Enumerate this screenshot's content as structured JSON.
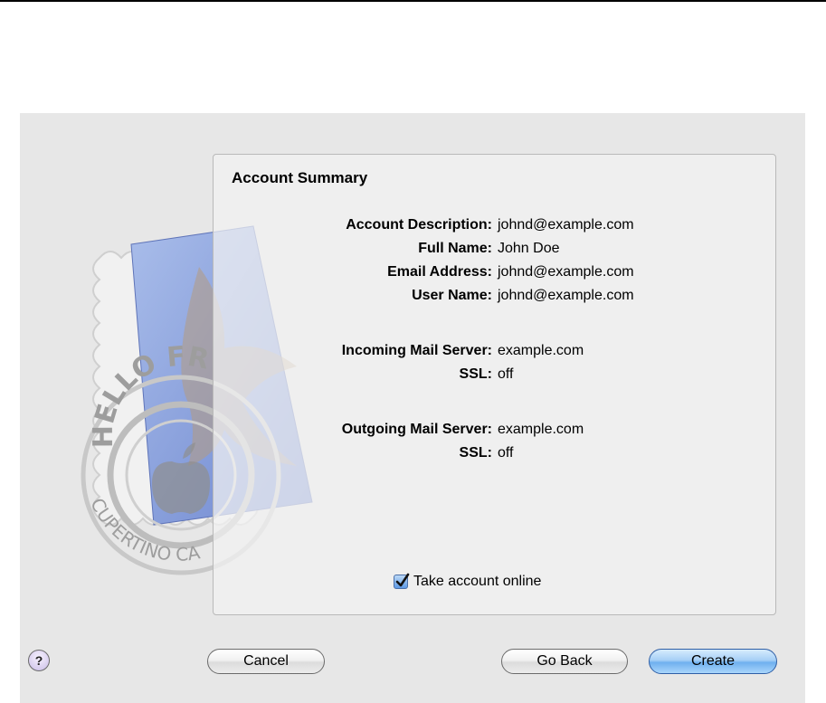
{
  "panel": {
    "title": "Account Summary",
    "rows": [
      {
        "label": "Account Description:",
        "value": "johnd@example.com"
      },
      {
        "label": "Full Name:",
        "value": "John Doe"
      },
      {
        "label": "Email Address:",
        "value": "johnd@example.com"
      },
      {
        "label": "User Name:",
        "value": "johnd@example.com"
      },
      {
        "label": "Incoming Mail Server:",
        "value": "example.com"
      },
      {
        "label": "SSL:",
        "value": "off"
      },
      {
        "label": "Outgoing Mail Server:",
        "value": "example.com"
      },
      {
        "label": "SSL:",
        "value": "off"
      }
    ],
    "take_online": {
      "label": "Take account online",
      "checked": true
    }
  },
  "stamp": {
    "top_text": "HELLO FR",
    "bottom_text": "CUPERTINO CA"
  },
  "buttons": {
    "help": "?",
    "cancel": "Cancel",
    "go_back": "Go Back",
    "create": "Create"
  },
  "icons": {
    "stamp": "mail-stamp-icon",
    "checkbox": "checkmark-icon"
  },
  "colors": {
    "dialog_bg": "#e7e7e7",
    "default_button": "#6fb0ef",
    "stamp_blue": "#7f9ad8"
  }
}
